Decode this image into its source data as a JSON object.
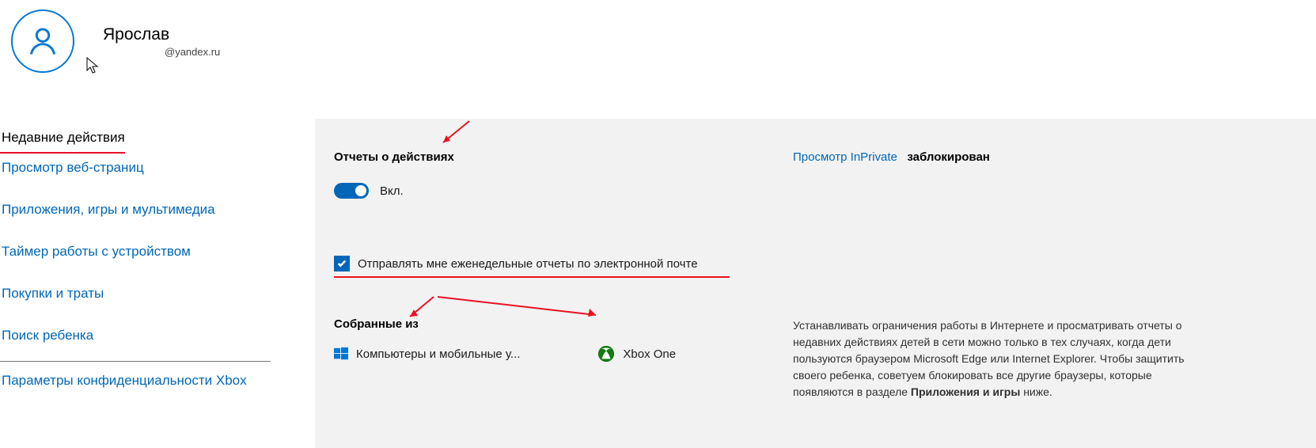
{
  "profile": {
    "name": "Ярослав",
    "email": "@yandex.ru"
  },
  "sidebar": {
    "items": [
      {
        "label": "Недавние действия",
        "active": true
      },
      {
        "label": "Просмотр веб-страниц"
      },
      {
        "label": "Приложения, игры и мультимедиа"
      },
      {
        "label": "Таймер работы с устройством"
      },
      {
        "label": "Покупки и траты"
      },
      {
        "label": "Поиск ребенка"
      }
    ],
    "secondary_item": "Параметры конфиденциальности Xbox"
  },
  "panel": {
    "reports_heading": "Отчеты о действиях",
    "toggle_state_label": "Вкл.",
    "inprivate_link": "Просмотр InPrivate",
    "inprivate_status": "заблокирован",
    "weekly_checkbox_label": "Отправлять мне еженедельные отчеты по электронной почте",
    "collected_heading": "Собранные из",
    "devices": {
      "windows": "Компьютеры и мобильные у...",
      "xbox": "Xbox One"
    },
    "hint_pre": "Устанавливать ограничения работы в Интернете и просматривать отчеты о недавних действиях детей в сети можно только в тех случаях, когда дети пользуются браузером Microsoft Edge или Internet Explorer. Чтобы защитить своего ребенка, советуем блокировать все другие браузеры, которые появляются в разделе ",
    "hint_bold": "Приложения и игры",
    "hint_post": " ниже."
  }
}
